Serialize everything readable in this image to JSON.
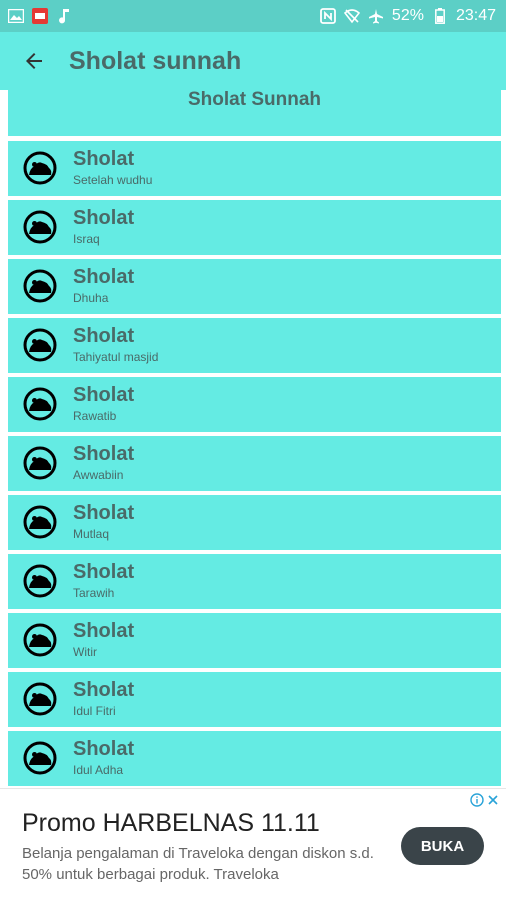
{
  "status_bar": {
    "battery": "52%",
    "time": "23:47"
  },
  "app_bar": {
    "title": "Sholat sunnah"
  },
  "header": {
    "title": "Sholat Sunnah"
  },
  "items": [
    {
      "title": "Sholat",
      "subtitle": "Setelah wudhu"
    },
    {
      "title": "Sholat",
      "subtitle": "Israq"
    },
    {
      "title": "Sholat",
      "subtitle": "Dhuha"
    },
    {
      "title": "Sholat",
      "subtitle": "Tahiyatul masjid"
    },
    {
      "title": "Sholat",
      "subtitle": "Rawatib"
    },
    {
      "title": "Sholat",
      "subtitle": "Awwabiin"
    },
    {
      "title": "Sholat",
      "subtitle": "Mutlaq"
    },
    {
      "title": "Sholat",
      "subtitle": "Tarawih"
    },
    {
      "title": "Sholat",
      "subtitle": "Witir"
    },
    {
      "title": "Sholat",
      "subtitle": "Idul Fitri"
    },
    {
      "title": "Sholat",
      "subtitle": "Idul Adha"
    }
  ],
  "ad": {
    "title": "Promo HARBELNAS 11.11",
    "description": "Belanja pengalaman di Traveloka dengan diskon s.d. 50% untuk berbagai produk. Traveloka",
    "button": "BUKA"
  },
  "colors": {
    "status_bar": "#5ccfc6",
    "app_bar": "#64ebe3",
    "card": "#64ebe3",
    "text": "#4a6a68",
    "ad_button": "#3a4449"
  },
  "icons": {
    "item": "prayer-icon",
    "back": "arrow-left-icon"
  }
}
